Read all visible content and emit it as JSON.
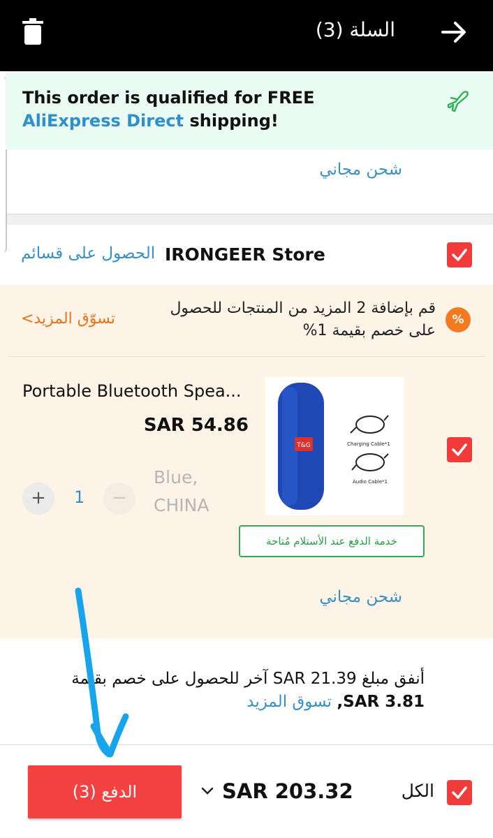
{
  "header": {
    "title": "السلة (3)"
  },
  "banner": {
    "text_before": "This order is qualified for FREE ",
    "link_text": "AliExpress Direct",
    "text_after": " shipping!"
  },
  "shipping": {
    "free_label_1": "شحن مجاني",
    "free_label_2": "شحن مجاني"
  },
  "store": {
    "name": "IRONGEER Store",
    "coupons_link": "الحصول على قسائم"
  },
  "promo": {
    "icon_text": "%",
    "line1": "قم بإضافة 2 المزيد من المنتجات للحصول",
    "line2": "على خصم بقيمة 1%",
    "shop_more": "تسوّق المزيد>"
  },
  "product": {
    "title": "Portable Bluetooth Spea...",
    "price": "SAR 54.86",
    "variant_line1": "Blue,",
    "variant_line2": "CHINA",
    "quantity": "1",
    "plus": "+",
    "minus": "−",
    "image_labels": {
      "brand": "T&G",
      "cable1": "Charging Cable*1",
      "cable2": "Audio Cable*1"
    },
    "cod_badge": "خدمة الدفع عند الأستلام مُتاحة"
  },
  "spend": {
    "line1": "أنفق مبلغ SAR 21.39 آخر للحصول على خصم بقيمة",
    "line2_value": "SAR 3.81,",
    "line2_link": "تسوق المزيد"
  },
  "footer": {
    "all_label": "الكل",
    "total": "SAR 203.32",
    "pay_button": "الدفع (3)"
  },
  "colors": {
    "accent_red": "#f44242",
    "link_blue": "#3a8fc4",
    "promo_orange": "#f47a20",
    "success_green": "#2b9a48"
  }
}
